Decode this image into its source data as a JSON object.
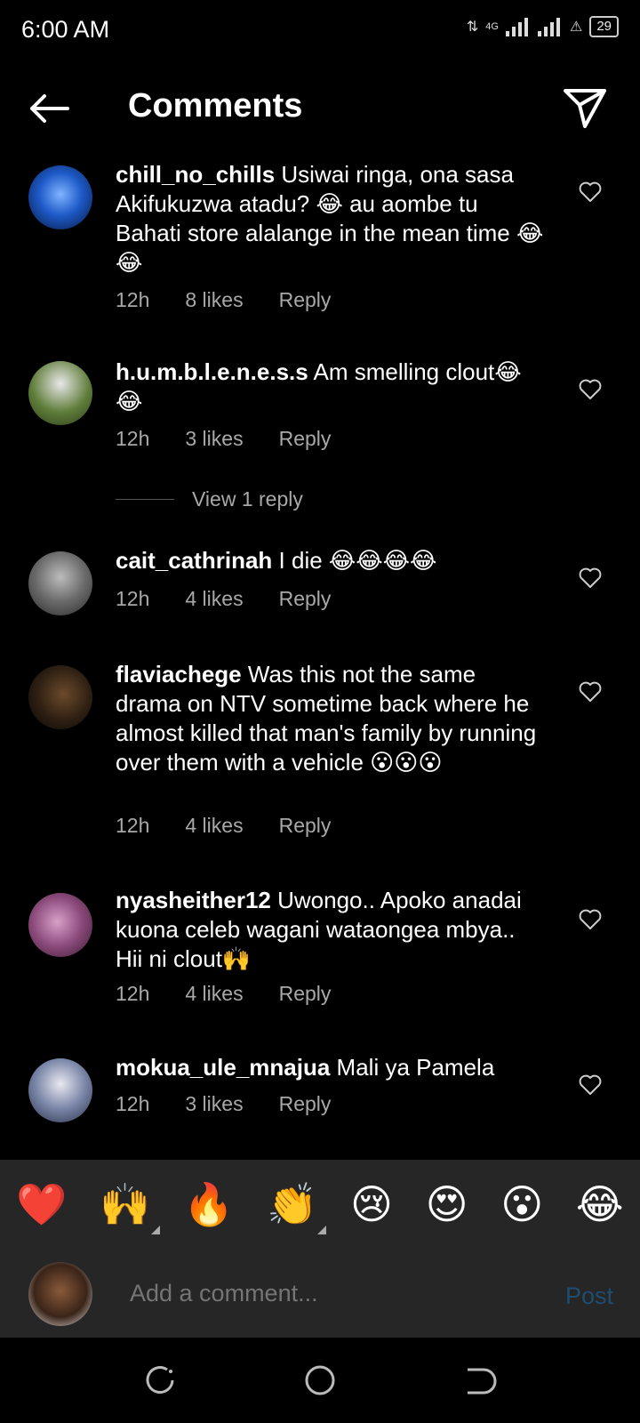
{
  "status_bar": {
    "time": "6:00 AM",
    "network": "4G",
    "battery": "29"
  },
  "header": {
    "title": "Comments"
  },
  "comments": [
    {
      "username": "chill_no_chills",
      "text": "Usiwai ringa, ona sasa Akifukuzwa atadu? 😂 au aombe tu Bahati store alalange in the mean time 😂😂",
      "time": "12h",
      "likes": "8 likes",
      "reply": "Reply"
    },
    {
      "username": "h.u.m.b.l.e.n.e.s.s",
      "text": "Am smelling clout😂😂",
      "time": "12h",
      "likes": "3 likes",
      "reply": "Reply",
      "view_replies": "View 1 reply"
    },
    {
      "username": "cait_cathrinah",
      "text": "I die 😂😂😂😂",
      "time": "12h",
      "likes": "4 likes",
      "reply": "Reply"
    },
    {
      "username": "flaviachege",
      "text": "Was this not the same drama on NTV sometime back where he almost killed that man's family by running over them with a vehicle 😮😮😮",
      "time": "12h",
      "likes": "4 likes",
      "reply": "Reply"
    },
    {
      "username": "nyasheither12",
      "text": "Uwongo.. Apoko anadai kuona celeb wagani wataongea mbya.. Hii ni clout🙌",
      "time": "12h",
      "likes": "4 likes",
      "reply": "Reply"
    },
    {
      "username": "mokua_ule_mnajua",
      "text": "Mali ya Pamela",
      "time": "12h",
      "likes": "3 likes",
      "reply": "Reply"
    }
  ],
  "emoji_bar": [
    "❤️",
    "🙌",
    "🔥",
    "👏",
    "😢",
    "😍",
    "😮",
    "😂"
  ],
  "comment_input": {
    "placeholder": "Add a comment...",
    "post_label": "Post"
  },
  "colors": {
    "background": "#000000",
    "panel": "#262626",
    "secondary_text": "#a8a8a8",
    "post_disabled": "#1e4d70"
  }
}
